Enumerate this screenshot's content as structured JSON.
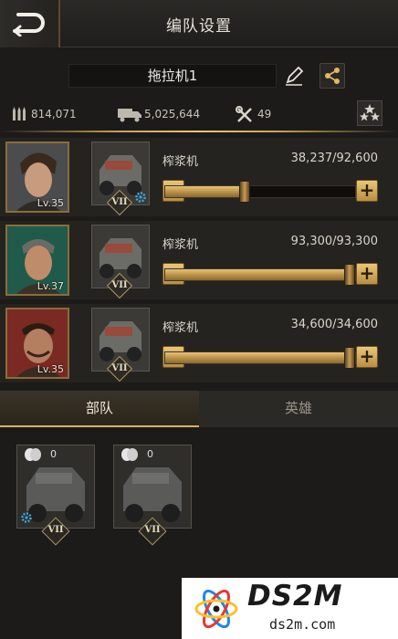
{
  "header": {
    "title": "编队设置"
  },
  "formation": {
    "name": "拖拉机1"
  },
  "stats": {
    "ammo": "814,071",
    "load": "5,025,644",
    "repair": "49"
  },
  "units": [
    {
      "hero_level": "Lv.35",
      "rank": "VII",
      "name": "榨浆机",
      "count": "38,237/92,600",
      "fill": 0.413,
      "has_gear": true
    },
    {
      "hero_level": "Lv.37",
      "rank": "VII",
      "name": "榨浆机",
      "count": "93,300/93,300",
      "fill": 1.0,
      "has_gear": false
    },
    {
      "hero_level": "Lv.35",
      "rank": "VII",
      "name": "榨浆机",
      "count": "34,600/34,600",
      "fill": 1.0,
      "has_gear": false
    }
  ],
  "tabs": [
    {
      "label": "部队",
      "active": true
    },
    {
      "label": "英雄",
      "active": false
    }
  ],
  "roster": [
    {
      "count": "0",
      "rank": "VII"
    },
    {
      "count": "0",
      "rank": "VII"
    }
  ],
  "watermark": {
    "brand": "DS2M",
    "domain": "ds2m.com"
  },
  "colors": {
    "accent_gold": "#d8b066",
    "background": "#1c1b19"
  }
}
